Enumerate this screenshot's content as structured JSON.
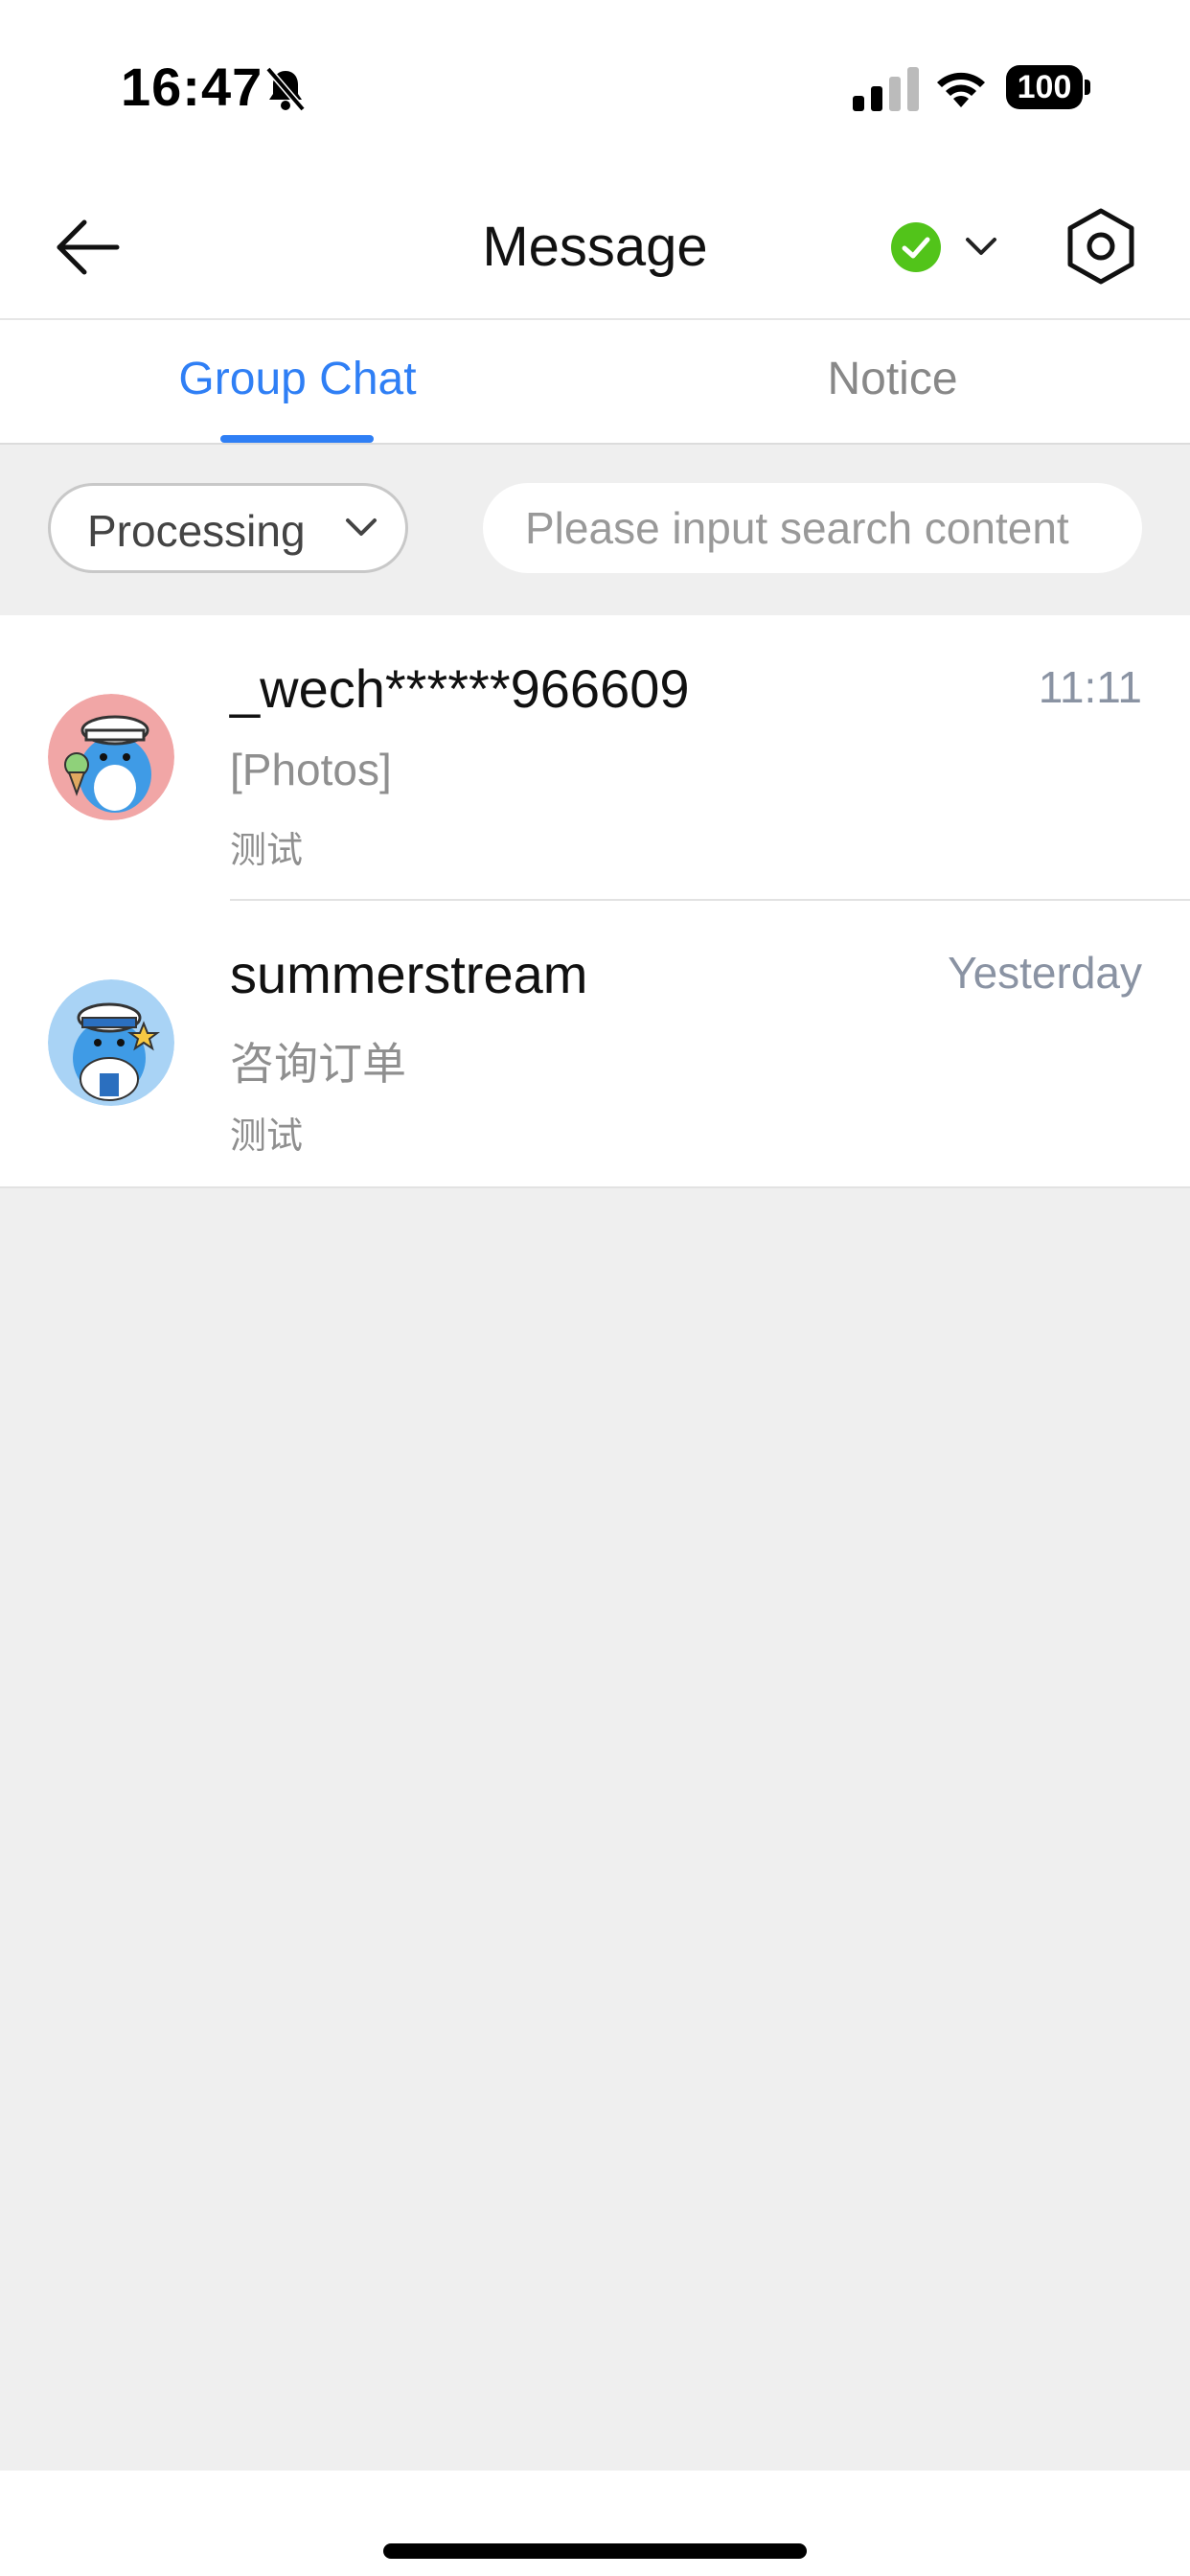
{
  "status_bar": {
    "time": "16:47",
    "battery": "100"
  },
  "header": {
    "title": "Message",
    "status_color": "#52c41a"
  },
  "tabs": [
    {
      "label": "Group Chat",
      "active": true
    },
    {
      "label": "Notice",
      "active": false
    }
  ],
  "filter": {
    "dropdown_value": "Processing",
    "search_placeholder": "Please input search content"
  },
  "conversations": [
    {
      "name": "_wech******966609",
      "time": "11:11",
      "preview": "[Photos]",
      "tag": "测试",
      "avatar": "dolphin-avatar-pink"
    },
    {
      "name": "summerstream",
      "time": "Yesterday",
      "preview": "咨询订单",
      "tag": "测试",
      "avatar": "dolphin-avatar-blue"
    }
  ],
  "colors": {
    "accent": "#2f7ff5",
    "online": "#52c41a",
    "background": "#efefef"
  }
}
